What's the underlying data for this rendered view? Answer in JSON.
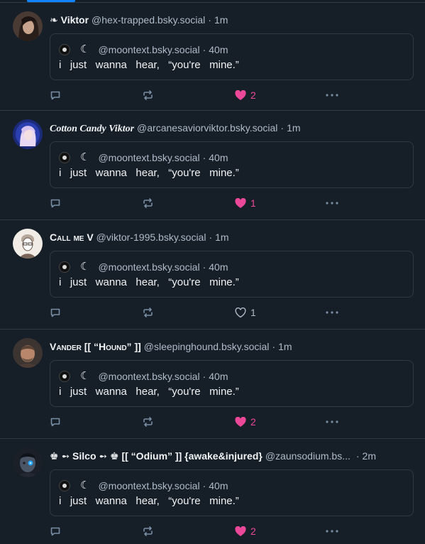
{
  "accent_color": "#1083fe",
  "like_color": "#ec4899",
  "posts": [
    {
      "display_name": "❧ Viktor",
      "handle": "@hex-trapped.bsky.social",
      "sep": "·",
      "time": "1m",
      "quote": {
        "handle": "@moontext.bsky.social",
        "sep": "·",
        "time": "40m",
        "moon": "☾",
        "text": "i   just   wanna   hear,   “you're   mine.”"
      },
      "likes": "2",
      "liked": true
    },
    {
      "display_name": "Cotton Candy Viktor",
      "handle": "@arcanesaviorviktor.bsky.social",
      "sep": "·",
      "time": "1m",
      "quote": {
        "handle": "@moontext.bsky.social",
        "sep": "·",
        "time": "40m",
        "moon": "☾",
        "text": "i   just   wanna   hear,   “you're   mine.”"
      },
      "likes": "1",
      "liked": true
    },
    {
      "display_name": "Call me V",
      "handle": "@viktor-1995.bsky.social",
      "sep": "·",
      "time": "1m",
      "quote": {
        "handle": "@moontext.bsky.social",
        "sep": "·",
        "time": "40m",
        "moon": "☾",
        "text": "i   just   wanna   hear,   “you're   mine.”"
      },
      "likes": "1",
      "liked": false
    },
    {
      "display_name": "Vander [[ “Hound” ]]",
      "handle": "@sleepinghound.bsky.social",
      "sep": "·",
      "time": "1m",
      "quote": {
        "handle": "@moontext.bsky.social",
        "sep": "·",
        "time": "40m",
        "moon": "☾",
        "text": "i   just   wanna   hear,   “you're   mine.”"
      },
      "likes": "2",
      "liked": true
    },
    {
      "display_name": "♚ ➻ Silco ➻ ♚ [[ “Odium” ]] {awake&injured}",
      "handle": "@zaunsodium.bs...",
      "sep": "·",
      "time": "2m",
      "quote": {
        "handle": "@moontext.bsky.social",
        "sep": "·",
        "time": "40m",
        "moon": "☾",
        "text": "i   just   wanna   hear,   “you're   mine.”"
      },
      "likes": "2",
      "liked": true
    }
  ]
}
